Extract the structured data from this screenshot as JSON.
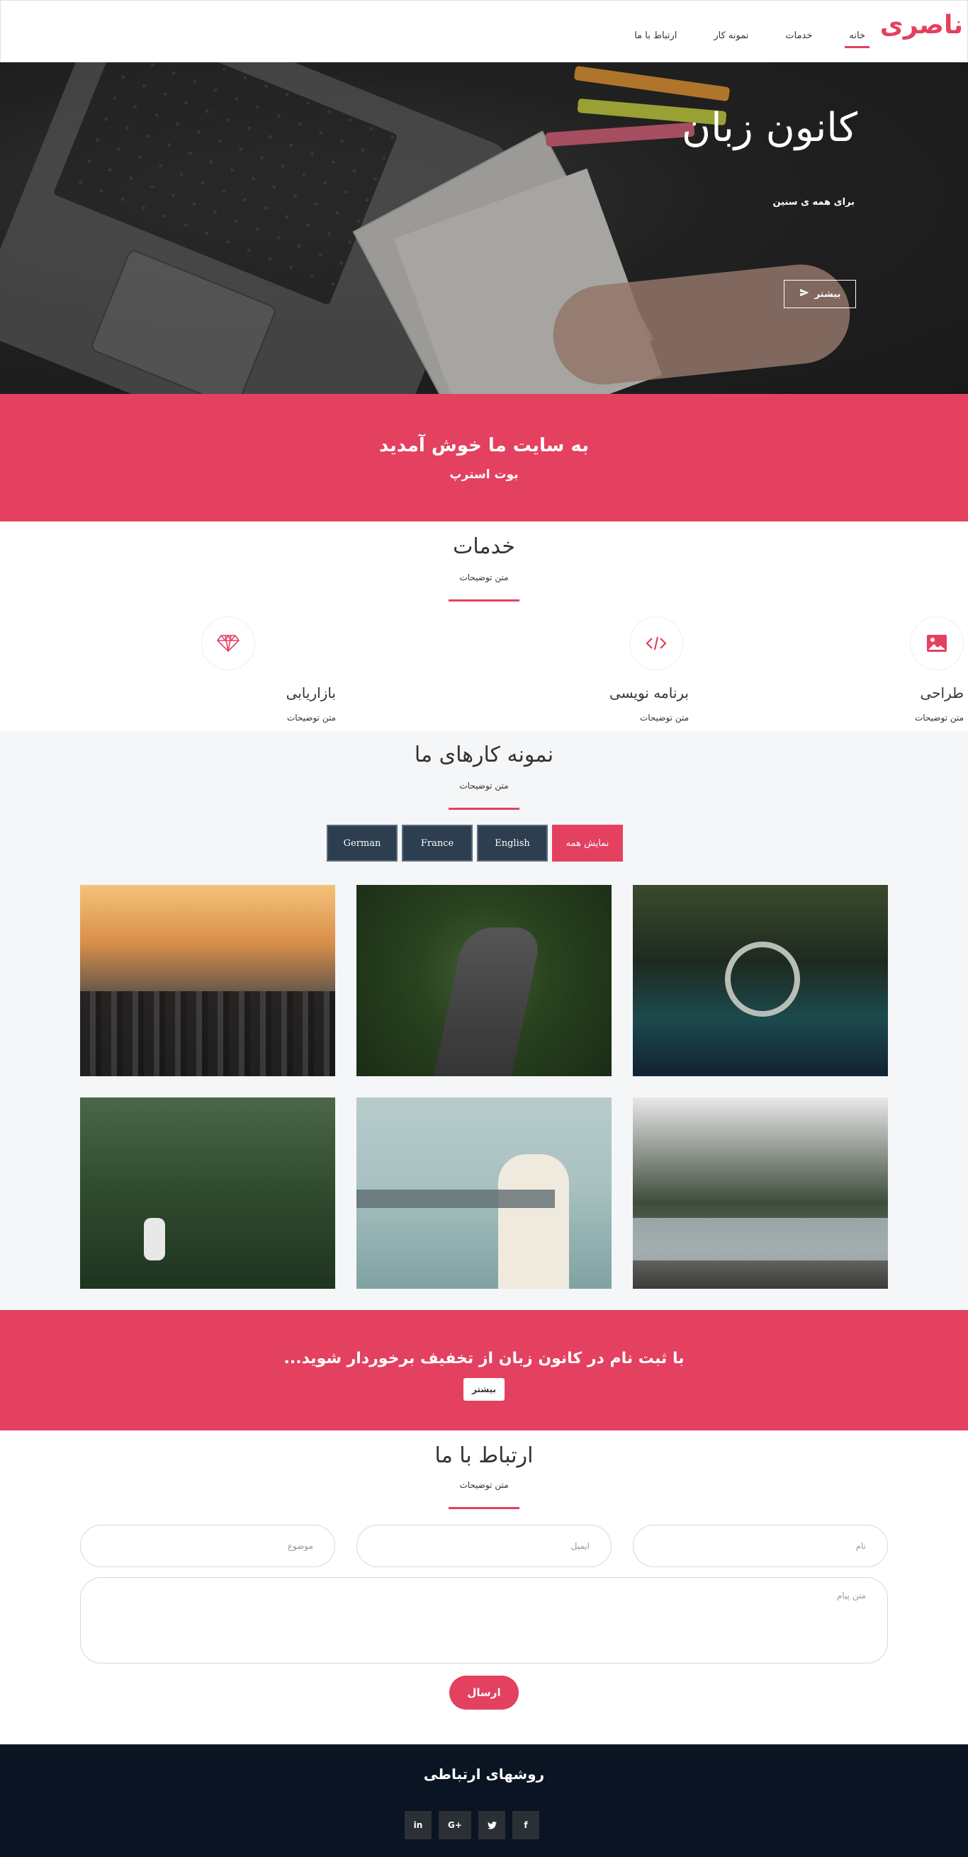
{
  "brand": "ناصری",
  "nav": {
    "items": [
      "خانه",
      "خدمات",
      "نمونه کار",
      "ارتباط با ما"
    ],
    "active": 0
  },
  "hero": {
    "title": "کانون زبان",
    "subtitle": "برای همه ی سنین",
    "button": "بیشتر",
    "button_icon": "paper-plane-icon"
  },
  "welcome": {
    "title": "به سایت ما خوش آمدید",
    "subtitle": "بوت استرپ"
  },
  "services": {
    "title": "خدمات",
    "description": "متن توضیحات",
    "items": [
      {
        "title": "طراحی",
        "description": "متن توضیحات",
        "icon": "image-icon"
      },
      {
        "title": "برنامه نویسی",
        "description": "متن توضیحات",
        "icon": "code-icon"
      },
      {
        "title": "بازاریابی",
        "description": "متن توضیحات",
        "icon": "diamond-icon"
      }
    ]
  },
  "portfolio": {
    "title": "نمونه کارهای ما",
    "description": "متن توضیحات",
    "filters": [
      "نمایش همه",
      "English",
      "France",
      "German"
    ],
    "active_filter": 0,
    "images": [
      "car-interior-photo",
      "forest-tunnel-photo",
      "city-sunset-photo",
      "river-valley-photo",
      "blindfold-sea-photo",
      "tree-climber-photo"
    ]
  },
  "cta": {
    "text": "با ثبت نام در کانون زبان از تخفیف برخوردار شوید...",
    "button": "بیشتر"
  },
  "contact": {
    "title": "ارتباط با ما",
    "description": "متن توضیحات",
    "name_placeholder": "نام",
    "email_placeholder": "ایمیل",
    "subject_placeholder": "موضوع",
    "message_placeholder": "متن پیام",
    "send": "ارسال"
  },
  "footer": {
    "title": "روشهای ارتباطی",
    "socials": [
      {
        "label": "in",
        "icon": "linkedin-icon"
      },
      {
        "label": "G+",
        "icon": "google-plus-icon"
      },
      {
        "label": "🐦",
        "icon": "twitter-icon"
      },
      {
        "label": "f",
        "icon": "facebook-icon"
      }
    ]
  },
  "colors": {
    "accent": "#e4405f",
    "filter_bg": "#2c3e50",
    "footer_bg": "#0a1422"
  }
}
